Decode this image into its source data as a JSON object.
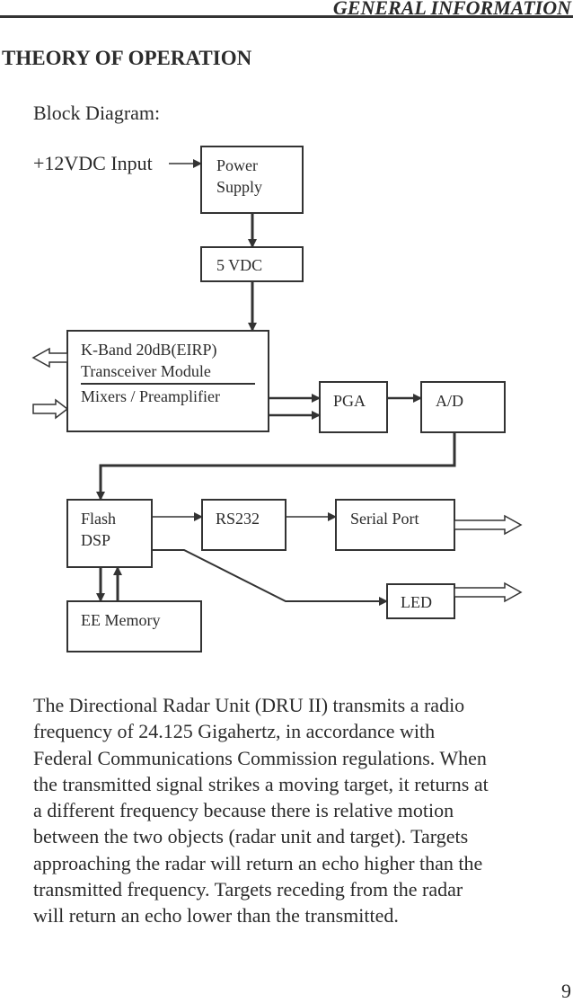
{
  "header": {
    "title": "GENERAL INFORMATION"
  },
  "section_title": "THEORY OF OPERATION",
  "subheading": "Block Diagram:",
  "diagram": {
    "input_label": "+12VDC Input",
    "blocks": {
      "power_supply": [
        "Power",
        "Supply"
      ],
      "vdc": "5 VDC",
      "transceiver": [
        "K-Band 20dB(EIRP)",
        "Transceiver Module",
        "Mixers / Preamplifier"
      ],
      "pga": "PGA",
      "ad": "A/D",
      "dsp": [
        "Flash",
        "DSP"
      ],
      "rs232": "RS232",
      "serial_port": "Serial Port",
      "led": "LED",
      "ee_memory": "EE Memory"
    }
  },
  "body_lines": [
    "The Directional Radar Unit (DRU II) transmits a radio",
    "frequency of 24.125 Gigahertz, in accordance with",
    "Federal Communications Commission regulations.  When",
    "the transmitted signal strikes a moving target, it returns at",
    "a different frequency because there is relative motion",
    "between the two objects (radar unit and target).  Targets",
    "approaching the radar will return an echo higher than the",
    "transmitted frequency.  Targets receding from the radar",
    "will return an echo lower than the transmitted."
  ],
  "page_number": "9"
}
